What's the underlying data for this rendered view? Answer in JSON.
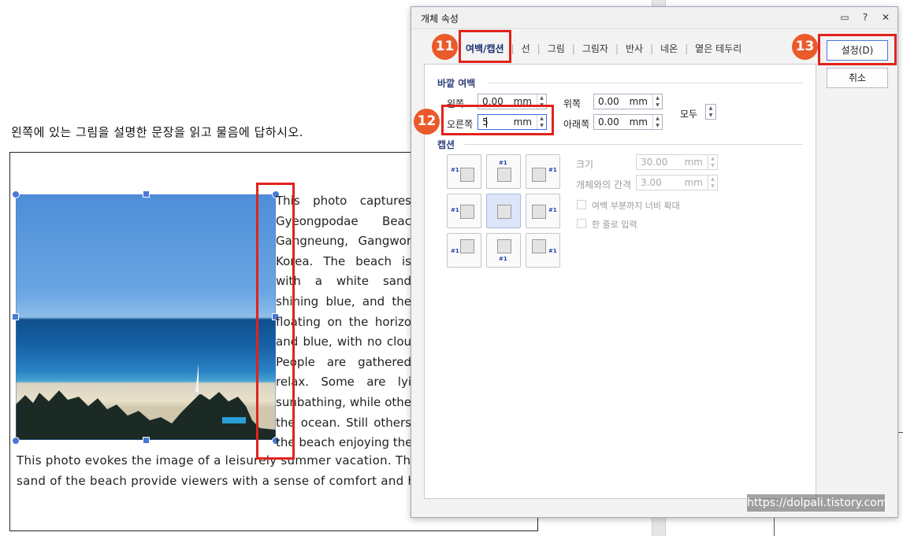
{
  "document": {
    "question": "왼쪽에 있는 그림을 설명한 문장을 읽고 물음에 답하시오.",
    "wrapped_lines": [
      "This photo captures",
      "Gyeongpodae Beac",
      "Gangneung, Gangwor",
      "Korea. The beach is",
      "with a white sand",
      "shining blue, and the",
      "floating on the horizo",
      "and blue, with no clou",
      "People are gathered",
      "relax. Some are lyi",
      "sunbathing, while othe",
      "the ocean. Still others",
      "the beach enjoying the"
    ],
    "full_lines": [
      "This photo evokes the image of a leisurely summer vacation. The",
      "sand of the beach provide viewers with a sense of comfort and h"
    ]
  },
  "dialog": {
    "title": "개체 속성",
    "title_icons": [
      "help-panel-icon",
      "question-icon",
      "close-icon"
    ],
    "title_glyphs": {
      "panel": "▭",
      "help": "?",
      "close": "✕"
    },
    "tabs": [
      {
        "label": "여백/캡션",
        "active": true
      },
      {
        "label": "선",
        "active": false
      },
      {
        "label": "그림",
        "active": false
      },
      {
        "label": "그림자",
        "active": false
      },
      {
        "label": "반사",
        "active": false
      },
      {
        "label": "네온",
        "active": false
      },
      {
        "label": "옅은 테두리",
        "active": false
      }
    ],
    "outer_margin": {
      "section_label": "바깥 여백",
      "left_label": "왼쪽",
      "left_value": "0.00",
      "left_unit": "mm",
      "right_label": "오른쪽",
      "right_value": "5",
      "right_unit": "mm",
      "top_label": "위쪽",
      "top_value": "0.00",
      "top_unit": "mm",
      "bottom_label": "아래쪽",
      "bottom_value": "0.00",
      "bottom_unit": "mm",
      "all_label": "모두"
    },
    "caption": {
      "section_label": "캡션",
      "size_label": "크기",
      "size_value": "30.00",
      "size_unit": "mm",
      "gap_label": "개체와의 간격",
      "gap_value": "3.00",
      "gap_unit": "mm",
      "extend_label": "여백 부분까지 너비 확대",
      "single_line_label": "한 줄로 입력",
      "position_tag": "#1",
      "selected_position": "center"
    },
    "buttons": {
      "ok": "설정(D)",
      "cancel": "취소"
    },
    "spin_arrows": {
      "up": "▲",
      "down": "▼"
    }
  },
  "badges": [
    "11",
    "12",
    "13"
  ],
  "watermark": "https://dolpali.tistory.com",
  "colors": {
    "badge": "#ea5a2a",
    "highlight": "#e0231c",
    "handle": "#4a78d8",
    "section": "#2d3e7a"
  }
}
